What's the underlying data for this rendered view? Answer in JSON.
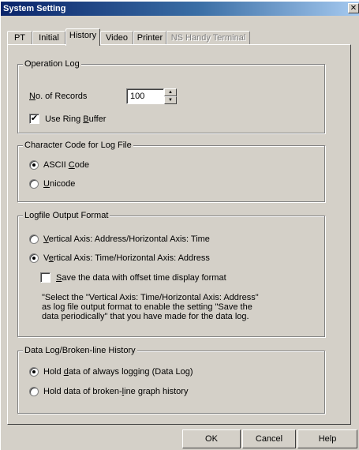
{
  "window": {
    "title": "System Setting",
    "close_glyph": "✕"
  },
  "tabs": [
    {
      "label": "PT",
      "state": "normal"
    },
    {
      "label": "Initial",
      "state": "normal"
    },
    {
      "label": "History",
      "state": "active"
    },
    {
      "label": "Video",
      "state": "normal"
    },
    {
      "label": "Printer",
      "state": "normal"
    },
    {
      "label": "NS Handy Terminal",
      "state": "disabled"
    }
  ],
  "operation_log": {
    "title": "Operation Log",
    "records_label_u": "N",
    "records_label_rest": "o. of Records",
    "records_value": "100",
    "ring_buffer_label_a": "Use Ring ",
    "ring_buffer_label_u": "B",
    "ring_buffer_label_b": "uffer",
    "ring_buffer_checked": true
  },
  "char_code": {
    "title": "Character Code for Log File",
    "opt1_a": "ASCII ",
    "opt1_u": "C",
    "opt1_b": "ode",
    "opt2_u": "U",
    "opt2_b": "nicode",
    "selected": "ASCII Code"
  },
  "logfile_format": {
    "title": "Logfile Output Format",
    "opt1_u": "V",
    "opt1_b": "ertical Axis: Address/Horizontal Axis: Time",
    "opt2_a": "V",
    "opt2_u": "e",
    "opt2_b": "rtical Axis: Time/Horizontal Axis: Address",
    "selected": "Vertical Axis: Time/Horizontal Axis: Address",
    "offset_u": "S",
    "offset_b": "ave the data with offset time display format",
    "offset_checked": false,
    "note": "\"Select the \"Vertical Axis: Time/Horizontal Axis: Address\"\nas log file output format to enable the setting \"Save the\ndata periodically\" that you have made for the data log."
  },
  "data_log": {
    "title": "Data Log/Broken-line History",
    "opt1_a": "Hold ",
    "opt1_u": "d",
    "opt1_b": "ata of always logging (Data Log)",
    "opt2_a": "Hold data of broken-",
    "opt2_u": "l",
    "opt2_b": "ine graph history",
    "selected": "Hold data of always logging (Data Log)"
  },
  "buttons": {
    "ok": "OK",
    "cancel": "Cancel",
    "help": "Help"
  },
  "icons": {
    "spin_up": "▲",
    "spin_down": "▼",
    "check_mark": "✔"
  }
}
